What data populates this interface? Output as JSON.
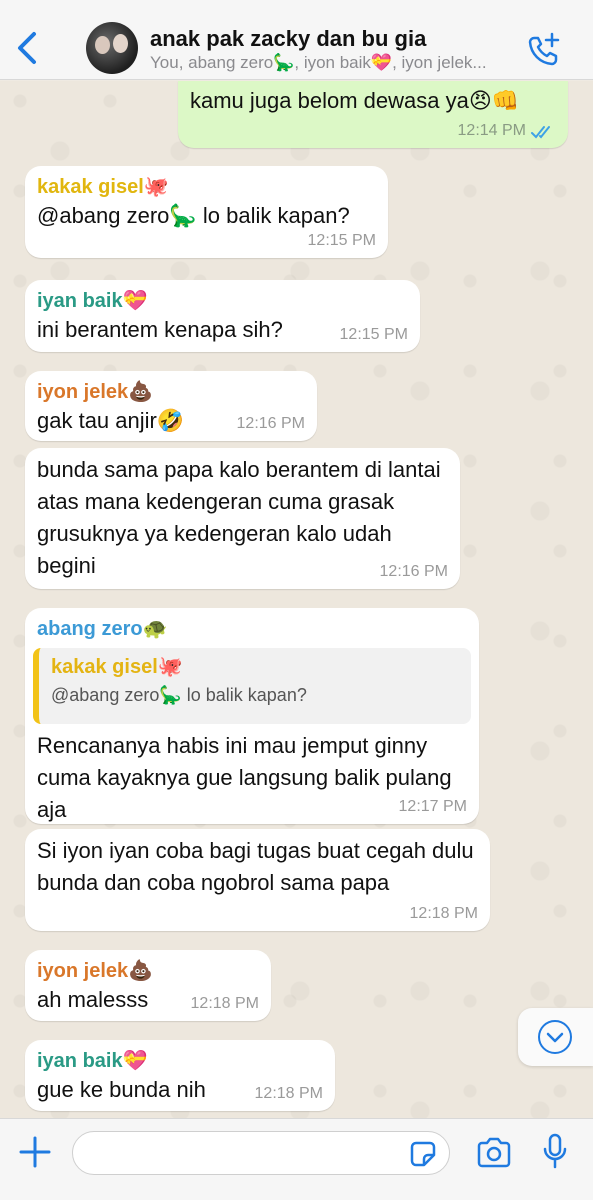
{
  "header": {
    "title": "anak pak zacky dan bu gia",
    "subtitle": "You, abang zero🦕, iyon baik💝, iyon jelek..."
  },
  "colors": {
    "yellow_sender": "#e1b60f",
    "teal_sender": "#2a9a85",
    "orange_sender": "#d9772a",
    "blue_sender": "#3c9ad6",
    "accent": "#1f7ae0"
  },
  "messages": [
    {
      "sender": "",
      "text": "kamu juga belom dewasa ya😠👊",
      "time": "12:14 PM"
    },
    {
      "sender": "kakak gisel🐙",
      "text": "@abang zero🦕 lo balik kapan?",
      "time": "12:15 PM"
    },
    {
      "sender": "iyan baik💝",
      "text": "ini berantem kenapa sih?",
      "time": "12:15 PM"
    },
    {
      "sender": "iyon jelek💩",
      "text": "gak tau anjir🤣",
      "time": "12:16 PM"
    },
    {
      "sender": "",
      "text": "bunda sama papa kalo berantem di lantai atas mana kedengeran cuma grasak grusuknya ya kedengeran kalo udah begini",
      "time": "12:16 PM"
    },
    {
      "sender": "abang zero🐢",
      "quote_sender": "kakak gisel🐙",
      "quote_text": "@abang zero🦕 lo balik kapan?",
      "text": "Rencananya habis ini mau jemput ginny cuma kayaknya gue langsung balik pulang aja",
      "time": "12:17 PM"
    },
    {
      "sender": "",
      "text": "Si iyon iyan coba bagi tugas buat cegah dulu bunda dan coba ngobrol sama papa",
      "time": "12:18 PM"
    },
    {
      "sender": "iyon jelek💩",
      "text": "ah malesss",
      "time": "12:18 PM"
    },
    {
      "sender": "iyan baik💝",
      "text": "gue ke bunda nih",
      "time": "12:18 PM"
    }
  ],
  "input": {
    "placeholder": ""
  }
}
